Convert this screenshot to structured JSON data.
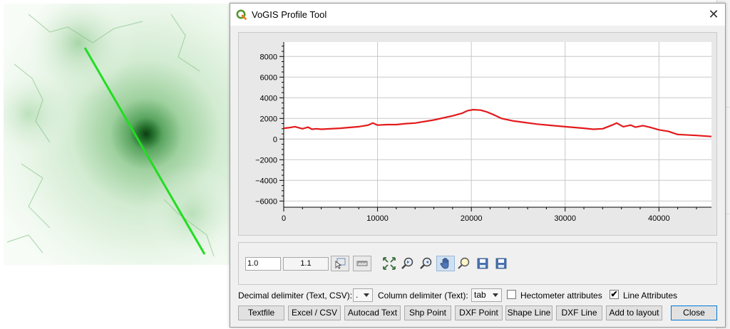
{
  "window": {
    "title": "VoGIS Profile Tool",
    "close_symbol": "✕",
    "app_icon": "qgis-q-icon"
  },
  "plot": {
    "line_color": "#e31a1c",
    "grid": true,
    "legend": "none"
  },
  "chart_data": {
    "type": "line",
    "title": "",
    "xlabel": "",
    "ylabel": "",
    "xlim": [
      0,
      45600
    ],
    "ylim": [
      -6600,
      9400
    ],
    "x_ticks": [
      0,
      10000,
      20000,
      30000,
      40000
    ],
    "x_tick_labels": [
      "0",
      "10000",
      "20000",
      "30000",
      "40000"
    ],
    "y_ticks": [
      -6000,
      -4000,
      -2000,
      0,
      2000,
      4000,
      6000,
      8000
    ],
    "y_tick_labels": [
      "−6000",
      "−4000",
      "−2000",
      "0",
      "2000",
      "4000",
      "6000",
      "8000"
    ],
    "series": [
      {
        "color": "#e31a1c",
        "x": [
          0,
          500,
          1200,
          2000,
          2600,
          3000,
          3500,
          4000,
          6000,
          8000,
          9000,
          9500,
          10000,
          11000,
          12000,
          13000,
          14000,
          16000,
          18000,
          19000,
          19600,
          20200,
          21000,
          21600,
          22400,
          23200,
          24500,
          27000,
          30000,
          32000,
          33000,
          34000,
          35000,
          35500,
          36200,
          37000,
          37500,
          38300,
          39000,
          40000,
          41000,
          42000,
          44000,
          45600
        ],
        "y": [
          1050,
          1100,
          1200,
          1000,
          1150,
          950,
          1000,
          950,
          1050,
          1200,
          1350,
          1550,
          1350,
          1400,
          1400,
          1500,
          1550,
          1850,
          2250,
          2500,
          2750,
          2850,
          2800,
          2650,
          2350,
          2000,
          1750,
          1450,
          1200,
          1050,
          950,
          1000,
          1350,
          1550,
          1200,
          1350,
          1150,
          1300,
          1150,
          900,
          750,
          450,
          350,
          250
        ]
      }
    ]
  },
  "toolbar": {
    "value_a": "1.0",
    "value_b": "1.1",
    "icons": [
      "select-feature-icon",
      "measure-icon",
      "zoom-full-icon",
      "zoom-in-icon",
      "zoom-out-icon",
      "pan-icon",
      "zoom-tool-icon",
      "save-icon",
      "save-as-icon"
    ]
  },
  "options": {
    "decimal_label": "Decimal delimiter (Text, CSV):",
    "decimal_value": ".",
    "column_label": "Column delimiter (Text):",
    "column_value": "tab",
    "hectometer_label": "Hectometer attributes",
    "hectometer_checked": false,
    "line_attr_label": "Line Attributes",
    "line_attr_checked": true,
    "check_mark": "✔"
  },
  "buttons": {
    "textfile": "Textfile",
    "excel_csv": "Excel / CSV",
    "autocad_text": "Autocad Text",
    "shp_point": "Shp Point",
    "dxf_point": "DXF Point",
    "shape_line": "Shape Line",
    "dxf_line": "DXF Line",
    "add_to_layout": "Add to layout",
    "close": "Close"
  },
  "map": {
    "profile_line_color": "#22dd22",
    "terrain_color": "#1d6e2a"
  }
}
